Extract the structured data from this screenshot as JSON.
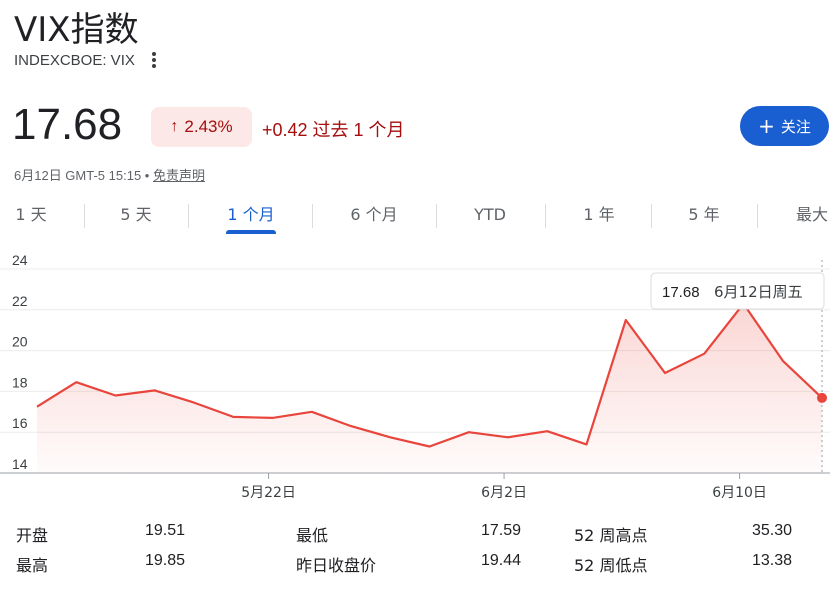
{
  "header": {
    "title": "VIX指数",
    "ticker": "INDEXCBOE: VIX",
    "more_icon": "more-vert-icon"
  },
  "quote": {
    "price": "17.68",
    "percent_change": "2.43%",
    "direction_icon": "arrow-up-icon",
    "change_text": "+0.42 过去 1 个月",
    "timestamp": "6月12日 GMT-5 15:15 • ",
    "disclaimer": "免责声明",
    "up_color": "#a50e0e",
    "badge_bg": "#fce8e6"
  },
  "follow_button": {
    "label": "关注",
    "icon": "plus-icon"
  },
  "tabs": [
    {
      "label": "1 天",
      "active": false
    },
    {
      "label": "5 天",
      "active": false
    },
    {
      "label": "1 个月",
      "active": true
    },
    {
      "label": "6 个月",
      "active": false
    },
    {
      "label": "YTD",
      "active": false
    },
    {
      "label": "1 年",
      "active": false
    },
    {
      "label": "5 年",
      "active": false
    },
    {
      "label": "最大",
      "active": false
    }
  ],
  "tooltip": {
    "value": "17.68",
    "date": "6月12日周五"
  },
  "chart_data": {
    "type": "line",
    "title": "",
    "xlabel": "",
    "ylabel": "",
    "ylim": [
      14,
      24
    ],
    "y_ticks": [
      24,
      22,
      20,
      18,
      16,
      14
    ],
    "x_ticks": [
      "5月22日",
      "6月2日",
      "6月10日"
    ],
    "x_tick_index": [
      5.9,
      11.9,
      17.9
    ],
    "grid": true,
    "line_color": "#e8453c",
    "series": [
      {
        "values": [
          17.25,
          18.45,
          17.8,
          18.05,
          17.45,
          16.75,
          16.7,
          17.0,
          16.3,
          15.75,
          15.3,
          16.0,
          15.75,
          16.05,
          15.4,
          21.5,
          18.9,
          19.85,
          22.3,
          19.5,
          17.68
        ]
      }
    ]
  },
  "stats": {
    "open_label": "开盘",
    "open": "19.51",
    "high_label": "最高",
    "high": "19.85",
    "low_label": "最低",
    "low": "17.59",
    "prev_close_label": "昨日收盘价",
    "prev_close": "19.44",
    "high52_label": "52 周高点",
    "high52": "35.30",
    "low52_label": "52 周低点",
    "low52": "13.38"
  }
}
